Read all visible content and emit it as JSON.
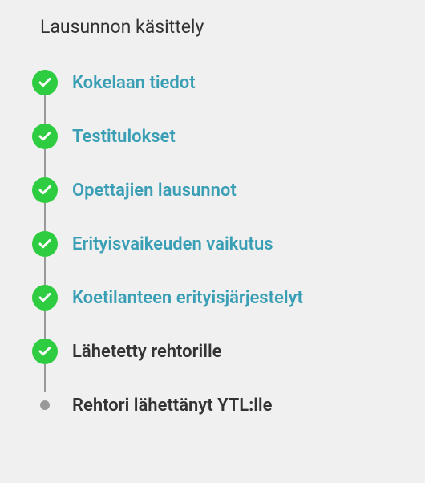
{
  "title": "Lausunnon käsittely",
  "colors": {
    "accent": "#3a9fb5",
    "success": "#2ecc40",
    "text": "#333",
    "line": "#999"
  },
  "steps": [
    {
      "label": "Kokelaan tiedot",
      "status": "done",
      "clickable": true
    },
    {
      "label": "Testitulokset",
      "status": "done",
      "clickable": true
    },
    {
      "label": "Opettajien lausunnot",
      "status": "done",
      "clickable": true
    },
    {
      "label": "Erityisvaikeuden vaikutus",
      "status": "done",
      "clickable": true
    },
    {
      "label": "Koetilanteen erityisjärjestelyt",
      "status": "done",
      "clickable": true
    },
    {
      "label": "Lähetetty rehtorille",
      "status": "done",
      "clickable": false
    },
    {
      "label": "Rehtori lähettänyt YTL:lle",
      "status": "pending",
      "clickable": false
    }
  ]
}
